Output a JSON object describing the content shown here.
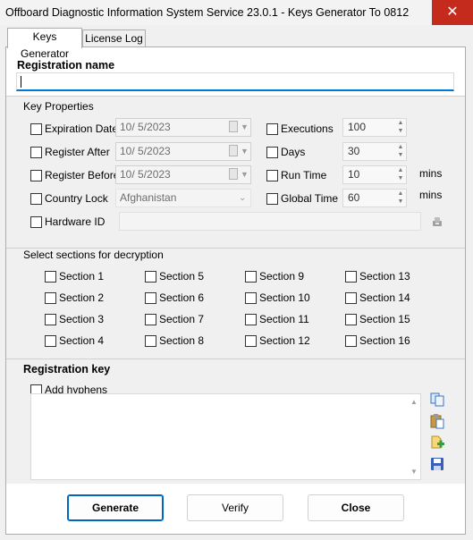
{
  "window": {
    "title": "Offboard Diagnostic Information System Service 23.0.1 - Keys Generator To 0812",
    "close_glyph": "✕"
  },
  "tabs": [
    {
      "label": "Keys Generator",
      "active": true
    },
    {
      "label": "License Log",
      "active": false
    }
  ],
  "registration_name": {
    "label": "Registration name",
    "value": ""
  },
  "key_properties": {
    "label": "Key Properties",
    "expiration_date": {
      "label": "Expiration Date",
      "value": "10/  5/2023",
      "checked": false
    },
    "register_after": {
      "label": "Register After",
      "value": "10/  5/2023",
      "checked": false
    },
    "register_before": {
      "label": "Register Before",
      "value": "10/  5/2023",
      "checked": false
    },
    "country_lock": {
      "label": "Country Lock",
      "value": "Afghanistan",
      "checked": false
    },
    "hardware_id": {
      "label": "Hardware ID",
      "value": "",
      "checked": false
    },
    "executions": {
      "label": "Executions",
      "value": "100",
      "checked": false
    },
    "days": {
      "label": "Days",
      "value": "30",
      "checked": false
    },
    "run_time": {
      "label": "Run Time",
      "value": "10",
      "unit": "mins",
      "checked": false
    },
    "global_time": {
      "label": "Global Time",
      "value": "60",
      "unit": "mins",
      "checked": false
    }
  },
  "sections": {
    "label": "Select sections for decryption",
    "items": [
      {
        "label": "Section 1"
      },
      {
        "label": "Section 5"
      },
      {
        "label": "Section 9"
      },
      {
        "label": "Section 13"
      },
      {
        "label": "Section 2"
      },
      {
        "label": "Section 6"
      },
      {
        "label": "Section 10"
      },
      {
        "label": "Section 14"
      },
      {
        "label": "Section 3"
      },
      {
        "label": "Section 7"
      },
      {
        "label": "Section 11"
      },
      {
        "label": "Section 15"
      },
      {
        "label": "Section 4"
      },
      {
        "label": "Section 8"
      },
      {
        "label": "Section 12"
      },
      {
        "label": "Section 16"
      }
    ]
  },
  "registration_key": {
    "label": "Registration key",
    "add_hyphens": {
      "label": "Add hyphens",
      "checked": false
    },
    "value": "",
    "icons": [
      "copy-icon",
      "paste-icon",
      "add-file-icon",
      "save-icon"
    ]
  },
  "buttons": {
    "generate": "Generate",
    "verify": "Verify",
    "close": "Close"
  },
  "colors": {
    "accent": "#0078d4",
    "titlebar_close": "#c42b1c"
  }
}
